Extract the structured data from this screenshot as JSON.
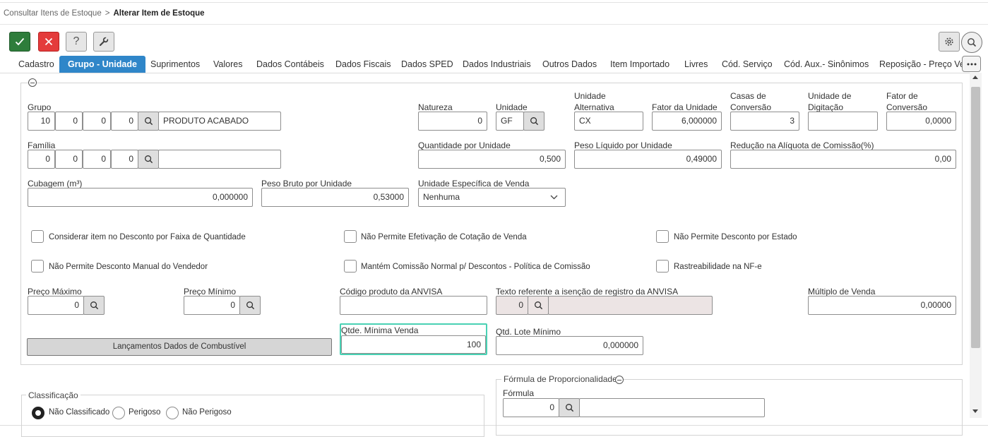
{
  "breadcrumb": {
    "parent": "Consultar Itens de Estoque",
    "separator": ">",
    "current": "Alterar Item de Estoque"
  },
  "toolbar": {
    "help": "?"
  },
  "tabs": [
    {
      "label": "Cadastro"
    },
    {
      "label": "Grupo - Unidade"
    },
    {
      "label": "Suprimentos"
    },
    {
      "label": "Valores"
    },
    {
      "label": "Dados Contábeis"
    },
    {
      "label": "Dados Fiscais"
    },
    {
      "label": "Dados SPED"
    },
    {
      "label": "Dados Industriais"
    },
    {
      "label": "Outros Dados"
    },
    {
      "label": "Item Importado"
    },
    {
      "label": "Livres"
    },
    {
      "label": "Cód. Serviço"
    },
    {
      "label": "Cód. Aux.- Sinônimos"
    },
    {
      "label": "Reposição - Preço Venda"
    }
  ],
  "form": {
    "grupo": {
      "label": "Grupo",
      "values": [
        "10",
        "0",
        "0",
        "0"
      ],
      "desc": "PRODUTO ACABADO"
    },
    "familia": {
      "label": "Família",
      "values": [
        "0",
        "0",
        "0",
        "0"
      ],
      "desc": ""
    },
    "natureza": {
      "label": "Natureza",
      "value": "0"
    },
    "unidade": {
      "label": "Unidade",
      "value": "GF"
    },
    "unidade_alternativa": {
      "label1": "Unidade",
      "label2": "Alternativa",
      "value": "CX"
    },
    "fator_unidade": {
      "label": "Fator da Unidade",
      "value": "6,000000"
    },
    "casas_conversao": {
      "label1": "Casas de",
      "label2": "Conversão",
      "value": "3"
    },
    "unidade_digitacao": {
      "label1": "Unidade de",
      "label2": "Digitação",
      "value": ""
    },
    "fator_conversao": {
      "label1": "Fator de",
      "label2": "Conversão",
      "value": "0,0000"
    },
    "quantidade_unidade": {
      "label": "Quantidade por Unidade",
      "value": "0,500"
    },
    "peso_liquido": {
      "label": "Peso Líquido por Unidade",
      "value": "0,49000"
    },
    "reducao_aliquota": {
      "label": "Redução na Alíquota de Comissão(%)",
      "value": "0,00"
    },
    "cubagem": {
      "label": "Cubagem (m³)",
      "value": "0,000000"
    },
    "peso_bruto": {
      "label": "Peso Bruto por Unidade",
      "value": "0,53000"
    },
    "unidade_especifica": {
      "label": "Unidade Específica de Venda",
      "value": "Nenhuma"
    },
    "checkboxes": [
      "Considerar item no Desconto por Faixa de Quantidade",
      "Não Permite Efetivação de Cotação de Venda",
      "Não Permite Desconto por Estado",
      "Não Permite Desconto Manual do Vendedor",
      "Mantém Comissão Normal p/ Descontos - Política de Comissão",
      "Rastreabilidade na NF-e"
    ],
    "preco_maximo": {
      "label": "Preço Máximo",
      "value": "0"
    },
    "preco_minimo": {
      "label": "Preço Mínimo",
      "value": "0"
    },
    "codigo_anvisa": {
      "label": "Código produto da ANVISA",
      "value": ""
    },
    "isencao_anvisa": {
      "label": "Texto referente a isenção de registro da ANVISA",
      "value": "0",
      "desc": ""
    },
    "multiplo_venda": {
      "label": "Múltiplo de Venda",
      "value": "0,00000"
    },
    "combustivel_button": "Lançamentos Dados de Combustível",
    "qtde_minima": {
      "label": "Qtde. Mínima Venda",
      "value": "100"
    },
    "qtd_lote": {
      "label": "Qtd. Lote Mínimo",
      "value": "0,000000"
    }
  },
  "classificacao": {
    "legend": "Classificação",
    "options": [
      "Não Classificado",
      "Perigoso",
      "Não Perigoso"
    ]
  },
  "formula_prop": {
    "legend": "Fórmula de Proporcionalidade",
    "label": "Fórmula",
    "value": "0",
    "desc": ""
  }
}
